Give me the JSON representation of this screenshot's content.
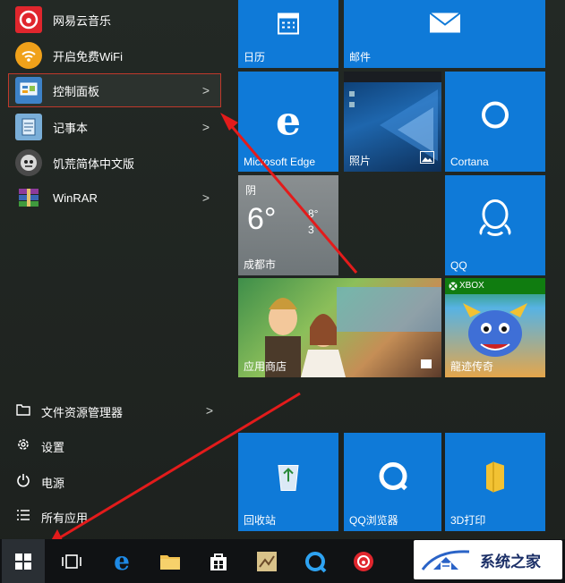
{
  "apps": [
    {
      "label": "网易云音乐",
      "icon": "netease-music-icon"
    },
    {
      "label": "开启免费WiFi",
      "icon": "wifi-icon"
    },
    {
      "label": "控制面板",
      "icon": "control-panel-icon",
      "has_submenu": true
    },
    {
      "label": "记事本",
      "icon": "notepad-icon",
      "has_submenu": true
    },
    {
      "label": "饥荒简体中文版",
      "icon": "dont-starve-icon"
    },
    {
      "label": "WinRAR",
      "icon": "winrar-icon",
      "has_submenu": true
    }
  ],
  "system_items": [
    {
      "label": "文件资源管理器",
      "icon": "file-explorer-icon",
      "has_submenu": true
    },
    {
      "label": "设置",
      "icon": "settings-icon"
    },
    {
      "label": "电源",
      "icon": "power-icon"
    },
    {
      "label": "所有应用",
      "icon": "all-apps-icon"
    }
  ],
  "chevron": ">",
  "tiles": {
    "calendar": "日历",
    "mail": "邮件",
    "edge": "Microsoft Edge",
    "photos": "照片",
    "cortana": "Cortana",
    "weather": {
      "condition": "阴",
      "temp": "6°",
      "high": "8°",
      "low": "3",
      "city": "成都市"
    },
    "qq": "QQ",
    "store": "应用商店",
    "xbox_badge": "XBOX",
    "game": "龍迹传奇",
    "recycle": "回收站",
    "qqbrowser": "QQ浏览器",
    "builder3d": "3D打印"
  },
  "watermark": "系统之家",
  "colors": {
    "tile": "#0f7ad8",
    "arrow": "#e31b1b",
    "highlight": "#c0392b",
    "taskbar": "#101214"
  }
}
